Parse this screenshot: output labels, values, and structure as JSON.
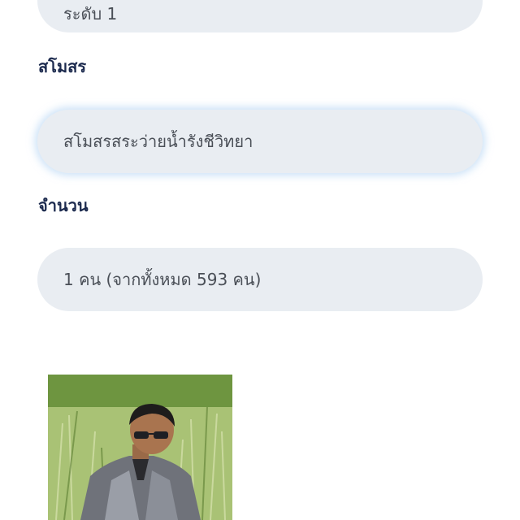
{
  "level": {
    "value": "ระดับ 1"
  },
  "club": {
    "label": "สโมสร",
    "value": "สโมสรสระว่ายน้ำรังชีวิทยา"
  },
  "count": {
    "label": "จำนวน",
    "value": "1 คน (จากทั้งหมด 593 คน)"
  },
  "photo": {
    "icon": "person-photo"
  }
}
